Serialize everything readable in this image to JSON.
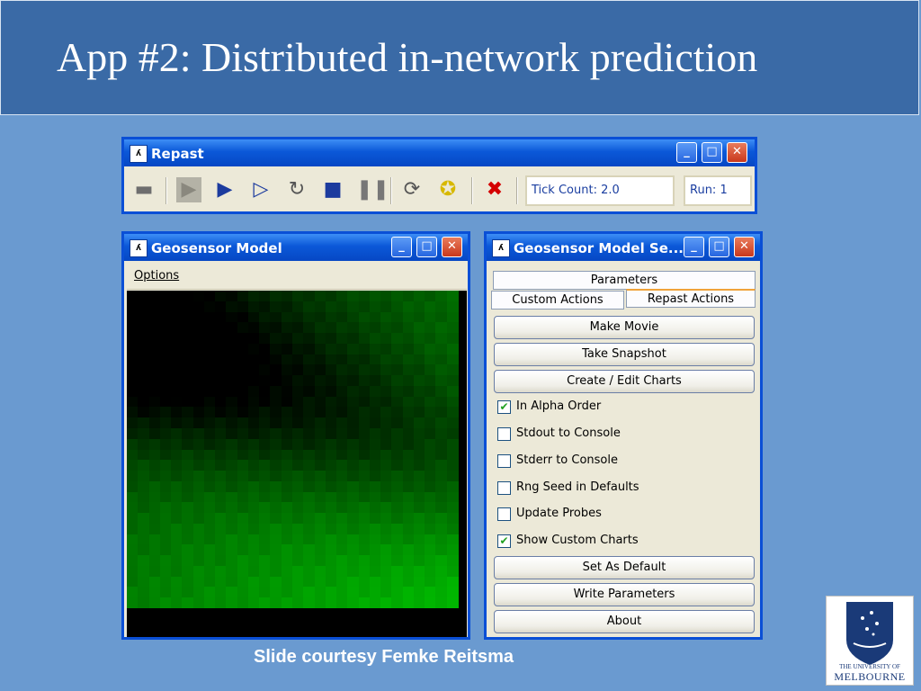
{
  "slide": {
    "title": "App #2: Distributed in-network prediction",
    "credit": "Slide courtesy Femke Reitsma"
  },
  "repast_window": {
    "title": "Repast",
    "toolbar_icons": [
      "folder-icon",
      "setup-icon",
      "play-icon",
      "step-icon",
      "restart-icon",
      "stop-icon",
      "pause-icon",
      "reset-icon",
      "lightbulb-icon",
      "exit-icon"
    ],
    "tick_count": "Tick Count: 2.0",
    "run": "Run: 1"
  },
  "model_window": {
    "title": "Geosensor Model",
    "menu": {
      "options": "Options"
    },
    "grid": {
      "cols": 30,
      "rows": 30
    }
  },
  "settings_window": {
    "title": "Geosensor Model Se...",
    "tabs": {
      "parameters": "Parameters",
      "custom_actions": "Custom Actions",
      "repast_actions": "Repast Actions"
    },
    "buttons": {
      "make_movie": "Make Movie",
      "take_snapshot": "Take Snapshot",
      "create_edit_charts": "Create / Edit Charts",
      "set_as_default": "Set As Default",
      "write_parameters": "Write Parameters",
      "about": "About"
    },
    "checkboxes": [
      {
        "label": "In Alpha Order",
        "checked": true
      },
      {
        "label": "Stdout to Console",
        "checked": false
      },
      {
        "label": "Stderr to Console",
        "checked": false
      },
      {
        "label": "Rng Seed in Defaults",
        "checked": false
      },
      {
        "label": "Update Probes",
        "checked": false
      },
      {
        "label": "Show Custom Charts",
        "checked": true
      }
    ]
  },
  "logo": {
    "line1": "THE UNIVERSITY OF",
    "line2": "MELBOURNE"
  },
  "colors": {
    "slide_bg": "#6a9ad0",
    "title_band": "#3a6aa6",
    "xp_blue": "#0a4fd6"
  }
}
